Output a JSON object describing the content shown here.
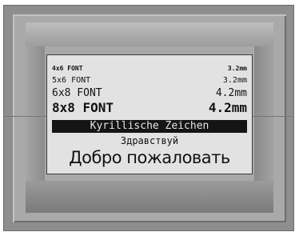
{
  "display": {
    "rows": [
      {
        "font": "4x6 FONT",
        "size": "3.2mm"
      },
      {
        "font": "5x6 FONT",
        "size": "3.2mm"
      },
      {
        "font": "6x8 FONT",
        "size": "4.2mm"
      },
      {
        "font": "8x8 FONT",
        "size": "4.2mm"
      }
    ],
    "inverse_line": "Kyrillische Zeichen",
    "cyrillic_small": "Здравствуй",
    "cyrillic_large": "Добро пожаловать"
  },
  "colors": {
    "bezel": "#8e8e8e",
    "screen_background": "#e1e2e1",
    "text": "#121212",
    "inverse_background": "#151515"
  }
}
